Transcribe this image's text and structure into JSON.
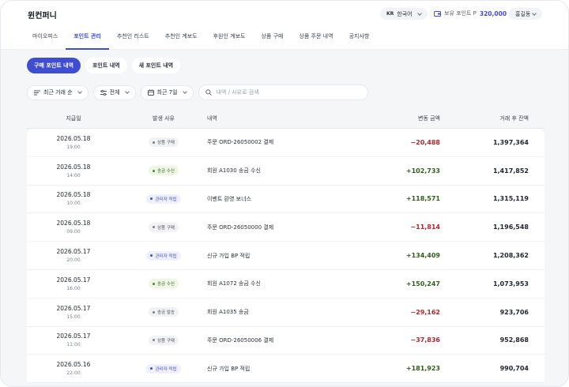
{
  "header": {
    "brand": "윈컨퍼니",
    "language": {
      "code": "KR",
      "label": "한국어"
    },
    "points": {
      "label": "보유 포인트 P",
      "value": "320,000"
    },
    "user": "홍길동"
  },
  "nav": [
    {
      "label": "마이오피스",
      "active": false
    },
    {
      "label": "포인트 관리",
      "active": true
    },
    {
      "label": "추천인 리스트",
      "active": false
    },
    {
      "label": "추천인 계보도",
      "active": false
    },
    {
      "label": "후원인 계보도",
      "active": false
    },
    {
      "label": "상품 구매",
      "active": false
    },
    {
      "label": "상품 주문 내역",
      "active": false
    },
    {
      "label": "공지사항",
      "active": false
    }
  ],
  "tabs": [
    {
      "label": "구매 포인트 내역",
      "active": true
    },
    {
      "label": "포인트 내역",
      "active": false
    },
    {
      "label": "새 포인트 내역",
      "active": false
    }
  ],
  "filters": {
    "sort": "최근 거래 순",
    "type": "전체",
    "period": "최근 7일",
    "search_placeholder": "내역 / 사유로 검색"
  },
  "table": {
    "columns": {
      "date": "지급일",
      "reason": "발생 사유",
      "desc": "내역",
      "amount": "변동 금액",
      "balance": "거래 후 잔액"
    },
    "rows": [
      {
        "date": "2026.05.18",
        "time": "19:00",
        "reason": "상품 구매",
        "kind": "buy",
        "desc": "주문 ORD-26050002 결제",
        "amount": "−20,488",
        "sign": "neg",
        "balance": "1,397,364"
      },
      {
        "date": "2026.05.18",
        "time": "14:00",
        "reason": "송금 수신",
        "kind": "recv",
        "desc": "회원 A1030 송금 수신",
        "amount": "+102,733",
        "sign": "pos",
        "balance": "1,417,852"
      },
      {
        "date": "2026.05.18",
        "time": "10:00",
        "reason": "관리자 적립",
        "kind": "admin",
        "desc": "이벤트 환영 보너스",
        "amount": "+118,571",
        "sign": "pos",
        "balance": "1,315,119"
      },
      {
        "date": "2026.05.18",
        "time": "09:00",
        "reason": "상품 구매",
        "kind": "buy",
        "desc": "주문 ORD-26050000 결제",
        "amount": "−11,814",
        "sign": "neg",
        "balance": "1,196,548"
      },
      {
        "date": "2026.05.17",
        "time": "20:00",
        "reason": "관리자 적립",
        "kind": "admin",
        "desc": "신규 가입 BP 적립",
        "amount": "+134,409",
        "sign": "pos",
        "balance": "1,208,362"
      },
      {
        "date": "2026.05.17",
        "time": "16:00",
        "reason": "송금 수신",
        "kind": "recv",
        "desc": "회원 A1072 송금 수신",
        "amount": "+150,247",
        "sign": "pos",
        "balance": "1,073,953"
      },
      {
        "date": "2026.05.17",
        "time": "15:00",
        "reason": "송금 발송",
        "kind": "send",
        "desc": "회원 A1035 송금",
        "amount": "−29,162",
        "sign": "neg",
        "balance": "923,706"
      },
      {
        "date": "2026.05.17",
        "time": "11:00",
        "reason": "상품 구매",
        "kind": "buy",
        "desc": "주문 ORD-26050006 결제",
        "amount": "−37,836",
        "sign": "neg",
        "balance": "952,868"
      },
      {
        "date": "2026.05.16",
        "time": "22:00",
        "reason": "관리자 적립",
        "kind": "admin",
        "desc": "신규 가입 BP 적립",
        "amount": "+181,923",
        "sign": "pos",
        "balance": "990,704"
      }
    ]
  }
}
